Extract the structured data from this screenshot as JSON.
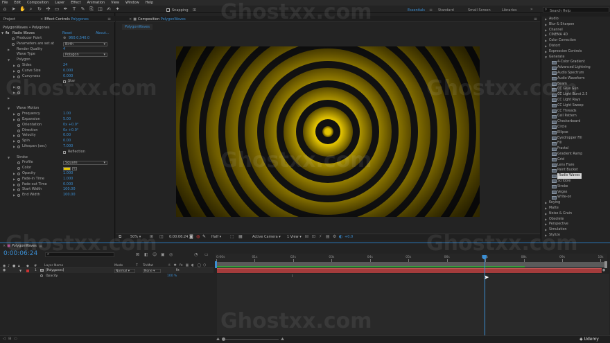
{
  "menu": [
    "File",
    "Edit",
    "Composition",
    "Layer",
    "Effect",
    "Animation",
    "View",
    "Window",
    "Help"
  ],
  "toolbar": {
    "snapping_label": "Snapping"
  },
  "workspaces": {
    "essentials": "Essentials",
    "standard": "Standard",
    "small_screen": "Small Screen",
    "libraries": "Libraries",
    "search_placeholder": "Search Help"
  },
  "panels": {
    "project_tab": "Project",
    "effect_controls_tab_prefix": "Effect Controls",
    "effect_controls_layer": "Polygones",
    "composition_tab_prefix": "Composition",
    "composition_name": "PolygonWaves",
    "comp_subtab": "PolygonWaves",
    "breadcrumb": "PolygonWaves • Polygones"
  },
  "effect_controls": {
    "effect_name": "Radio Waves",
    "reset_label": "Reset",
    "about_label": "About...",
    "rows": [
      {
        "indent": 0,
        "twirl": "",
        "stopwatch": true,
        "label": "Producer Point",
        "value": "960.0,540.0",
        "crosshair": true
      },
      {
        "indent": 0,
        "twirl": "",
        "stopwatch": true,
        "label": "Parameters are set at",
        "dropdown": "Birth"
      },
      {
        "indent": 0,
        "twirl": "▶",
        "stopwatch": false,
        "label": "Render Quality",
        "value": "4"
      },
      {
        "indent": 0,
        "twirl": "",
        "stopwatch": false,
        "label": "Wave Type",
        "dropdown": "Polygon"
      },
      {
        "indent": 0,
        "twirl": "▼",
        "stopwatch": false,
        "label": "Polygon"
      },
      {
        "indent": 1,
        "twirl": "▶",
        "stopwatch": true,
        "label": "Sides",
        "value": "24"
      },
      {
        "indent": 1,
        "twirl": "▶",
        "stopwatch": true,
        "label": "Curve Size",
        "value": "0.000"
      },
      {
        "indent": 1,
        "twirl": "▶",
        "stopwatch": true,
        "label": "Curvyness",
        "value": "0.000"
      },
      {
        "indent": 1,
        "twirl": "",
        "stopwatch": false,
        "label": "",
        "checkbox": "Star"
      },
      {
        "indent": 1,
        "twirl": "▶",
        "stopwatch": true,
        "label": "",
        "value": ""
      },
      {
        "indent": 1,
        "twirl": "▶",
        "stopwatch": true,
        "label": "",
        "value": ""
      },
      {
        "indent": 0,
        "twirl": "▶",
        "stopwatch": false,
        "label": "",
        "value": ""
      },
      {
        "indent": 0,
        "twirl": "",
        "stopwatch": false,
        "label": "",
        "value": ""
      },
      {
        "indent": 0,
        "twirl": "▼",
        "stopwatch": false,
        "label": "Wave Motion"
      },
      {
        "indent": 1,
        "twirl": "▶",
        "stopwatch": true,
        "label": "Frequency",
        "value": "1.00"
      },
      {
        "indent": 1,
        "twirl": "▶",
        "stopwatch": true,
        "label": "Expansion",
        "value": "5.00"
      },
      {
        "indent": 1,
        "twirl": "",
        "stopwatch": true,
        "label": "Orientation",
        "value": "0x +0.0°"
      },
      {
        "indent": 1,
        "twirl": "",
        "stopwatch": true,
        "label": "Direction",
        "value": "0x +0.0°"
      },
      {
        "indent": 1,
        "twirl": "▶",
        "stopwatch": true,
        "label": "Velocity",
        "value": "0.00"
      },
      {
        "indent": 1,
        "twirl": "▶",
        "stopwatch": true,
        "label": "Spin",
        "value": "0.00"
      },
      {
        "indent": 1,
        "twirl": "▶",
        "stopwatch": true,
        "label": "Lifespan (sec)",
        "value": "7.000"
      },
      {
        "indent": 1,
        "twirl": "",
        "stopwatch": false,
        "label": "",
        "checkbox": "Reflection"
      },
      {
        "indent": 0,
        "twirl": "▼",
        "stopwatch": false,
        "label": "Stroke"
      },
      {
        "indent": 1,
        "twirl": "",
        "stopwatch": true,
        "label": "Profile",
        "dropdown": "Square"
      },
      {
        "indent": 1,
        "twirl": "",
        "stopwatch": true,
        "label": "Color",
        "color": "#e8c800"
      },
      {
        "indent": 1,
        "twirl": "▶",
        "stopwatch": true,
        "label": "Opacity",
        "value": "1.000"
      },
      {
        "indent": 1,
        "twirl": "▶",
        "stopwatch": true,
        "label": "Fade-in Time",
        "value": "1.000"
      },
      {
        "indent": 1,
        "twirl": "▶",
        "stopwatch": true,
        "label": "Fade-out Time",
        "value": "0.000"
      },
      {
        "indent": 1,
        "twirl": "▶",
        "stopwatch": true,
        "label": "Start Width",
        "value": "100.00"
      },
      {
        "indent": 1,
        "twirl": "▶",
        "stopwatch": true,
        "label": "End Width",
        "value": "100.00"
      }
    ]
  },
  "viewer": {
    "zoom": "50%",
    "timecode": "0:00:06:24",
    "resolution": "Half",
    "camera": "Active Camera",
    "views": "1 View",
    "exposure": "+0.0",
    "ring_count": 7,
    "ring_color": "#e8c800",
    "gap_color": "#111111",
    "background": "#111111"
  },
  "effects_presets": {
    "items": [
      {
        "type": "cat",
        "twirl": "▶",
        "label": "Audio"
      },
      {
        "type": "cat",
        "twirl": "▶",
        "label": "Blur & Sharpen"
      },
      {
        "type": "cat",
        "twirl": "▶",
        "label": "Channel"
      },
      {
        "type": "cat",
        "twirl": "▶",
        "label": "CINEMA 4D"
      },
      {
        "type": "cat",
        "twirl": "▶",
        "label": "Color Correction"
      },
      {
        "type": "cat",
        "twirl": "▶",
        "label": "Distort"
      },
      {
        "type": "cat",
        "twirl": "▶",
        "label": "Expression Controls"
      },
      {
        "type": "cat",
        "twirl": "▼",
        "label": "Generate"
      },
      {
        "type": "fx",
        "label": "4-Color Gradient"
      },
      {
        "type": "fx",
        "label": "Advanced Lightning"
      },
      {
        "type": "fx",
        "label": "Audio Spectrum"
      },
      {
        "type": "fx",
        "label": "Audio Waveform"
      },
      {
        "type": "fx",
        "label": "Beam"
      },
      {
        "type": "fx",
        "label": "CC Glue Gun"
      },
      {
        "type": "fx",
        "label": "CC Light Burst 2.5"
      },
      {
        "type": "fx",
        "label": "CC Light Rays"
      },
      {
        "type": "fx",
        "label": "CC Light Sweep"
      },
      {
        "type": "fx",
        "label": "CC Threads"
      },
      {
        "type": "fx",
        "label": "Cell Pattern"
      },
      {
        "type": "fx",
        "label": "Checkerboard"
      },
      {
        "type": "fx",
        "label": "Circle"
      },
      {
        "type": "fx",
        "label": "Ellipse"
      },
      {
        "type": "fx",
        "label": "Eyedropper Fill"
      },
      {
        "type": "fx",
        "label": "Fill"
      },
      {
        "type": "fx",
        "label": "Fractal"
      },
      {
        "type": "fx",
        "label": "Gradient Ramp"
      },
      {
        "type": "fx",
        "label": "Grid"
      },
      {
        "type": "fx",
        "label": "Lens Flare"
      },
      {
        "type": "fx",
        "label": "Paint Bucket"
      },
      {
        "type": "fx",
        "label": "Radio Waves",
        "selected": true
      },
      {
        "type": "fx",
        "label": "Scribble"
      },
      {
        "type": "fx",
        "label": "Stroke"
      },
      {
        "type": "fx",
        "label": "Vegas"
      },
      {
        "type": "fx",
        "label": "Write-on"
      },
      {
        "type": "cat",
        "twirl": "▶",
        "label": "Keying"
      },
      {
        "type": "cat",
        "twirl": "▶",
        "label": "Matte"
      },
      {
        "type": "cat",
        "twirl": "▶",
        "label": "Noise & Grain"
      },
      {
        "type": "cat",
        "twirl": "▶",
        "label": "Obsolete"
      },
      {
        "type": "cat",
        "twirl": "▶",
        "label": "Perspective"
      },
      {
        "type": "cat",
        "twirl": "▶",
        "label": "Simulation"
      },
      {
        "type": "cat",
        "twirl": "▶",
        "label": "Stylize"
      }
    ]
  },
  "timeline": {
    "tab_label": "PolygonWaves",
    "timecode": "0:00:06:24",
    "search_placeholder": "",
    "col_layer_name": "Layer Name",
    "col_mode": "Mode",
    "col_trkmat": "TrkMat",
    "layer_number": "1",
    "layer_name": "[Polygones]",
    "layer_mode": "Normal",
    "layer_trkmat": "None",
    "prop_name": "Opacity",
    "prop_value": "100 %",
    "ruler_labels": [
      "0:00s",
      "01s",
      "02s",
      "03s",
      "04s",
      "05s",
      "06s",
      "07s",
      "08s",
      "09s",
      "10s"
    ],
    "playhead_fraction": 0.691
  },
  "watermark": {
    "text": "Ghostxx.com"
  },
  "udemy": {
    "label": "Udemy"
  }
}
